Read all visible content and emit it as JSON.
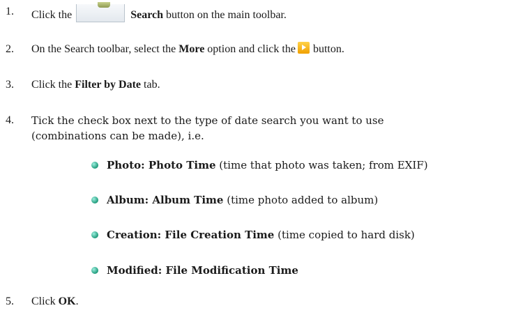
{
  "steps": [
    {
      "num": "1.",
      "before": "Click the",
      "bold": "Search",
      "after": "button on the main toolbar."
    },
    {
      "num": "2.",
      "before": "On the Search toolbar, select the",
      "bold": "More",
      "middle": "option and click the",
      "after": "button."
    },
    {
      "num": "3.",
      "before": "Click the",
      "bold": "Filter by Date",
      "after": "tab."
    },
    {
      "num": "4.",
      "line1": "Tick the check box next to the type of date search you want to use",
      "line2": "(combinations can be made), i.e."
    },
    {
      "num": "5.",
      "before": "Click",
      "bold": "OK",
      "after": "."
    }
  ],
  "bullets": [
    {
      "bold": "Photo: Photo Time",
      "rest": "(time that photo was taken; from EXIF)"
    },
    {
      "bold": "Album: Album Time",
      "rest": "(time photo added to album)"
    },
    {
      "bold": "Creation: File Creation Time",
      "rest": "(time copied to hard disk)"
    },
    {
      "bold": "Modified: File Modification Time",
      "rest": ""
    }
  ],
  "icons": {
    "search_button": "search-toolbar-button-icon",
    "go_button": "orange-play-arrow-icon"
  }
}
